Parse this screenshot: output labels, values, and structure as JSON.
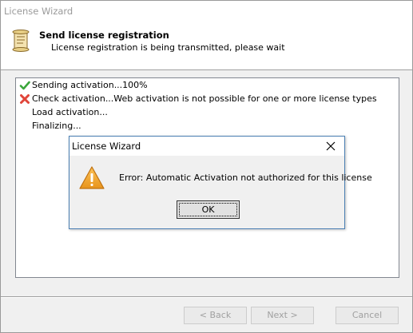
{
  "window": {
    "title": "License Wizard"
  },
  "header": {
    "title": "Send license registration",
    "subtitle": "License registration is being transmitted, please wait",
    "icon": "scroll-icon"
  },
  "log": {
    "lines": [
      {
        "text": "Sending activation...100%",
        "status": "success",
        "icon": "checkmark-icon"
      },
      {
        "text": "Check activation...Web activation is not possible for one or more license types",
        "status": "error",
        "icon": "red-x-icon"
      },
      {
        "text": "Load activation...",
        "status": "pending",
        "icon": ""
      },
      {
        "text": "Finalizing...",
        "status": "pending",
        "icon": ""
      }
    ]
  },
  "footer": {
    "back_label": "< Back",
    "next_label": "Next >",
    "cancel_label": "Cancel"
  },
  "dialog": {
    "title": "License Wizard",
    "message": "Error: Automatic Activation not authorized for this license",
    "ok_label": "OK",
    "icon": "warning-icon"
  },
  "colors": {
    "accent": "#4a7fb3",
    "warning": "#f5a623",
    "success": "#3aa63a",
    "error": "#e0453a"
  }
}
